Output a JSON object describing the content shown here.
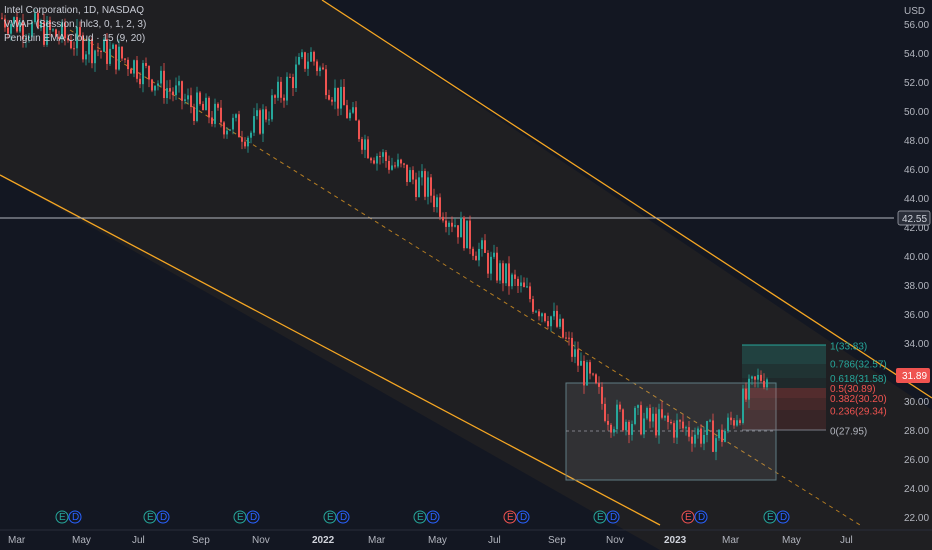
{
  "legend": {
    "symbol": "Intel Corporation, 1D, NASDAQ",
    "vwap": "VWAP (Session, hlc3, 0, 1, 2, 3)",
    "ema_cloud": "Penguin EMA Cloud · 15 (9, 20)"
  },
  "axis": {
    "currency": "USD",
    "y_labels": [
      "56.00",
      "54.00",
      "52.00",
      "50.00",
      "48.00",
      "46.00",
      "44.00",
      "42.00",
      "40.00",
      "38.00",
      "36.00",
      "34.00",
      "32.00",
      "30.00",
      "28.00",
      "26.00",
      "24.00",
      "22.00"
    ],
    "x_labels": [
      "Mar",
      "May",
      "Jul",
      "Sep",
      "Nov",
      "2022",
      "Mar",
      "May",
      "Jul",
      "Sep",
      "Nov",
      "2023",
      "Mar",
      "May",
      "Jul"
    ]
  },
  "tags": {
    "horizontal_line": "42.55",
    "last_price": "31.89"
  },
  "fib": {
    "labels": [
      "1(33.83)",
      "0.786(32.57)",
      "0.618(31.58)",
      "0.5(30.89)",
      "0.382(30.20)",
      "0.236(29.34)",
      "0(27.95)"
    ]
  },
  "colors": {
    "background": "#131722",
    "channel": "#f5a623",
    "up": "#26a69a",
    "down": "#ef5350",
    "hline": "#b2b5be",
    "fib_green": "#26a69a",
    "fib_red": "#ef5350"
  },
  "event_markers": [
    "E",
    "D",
    "E",
    "D",
    "E",
    "D",
    "E",
    "D",
    "E",
    "D",
    "E",
    "D",
    "E",
    "D",
    "E",
    "D",
    "E",
    "D"
  ],
  "chart_data": {
    "type": "candlestick",
    "title": "Intel Corporation, 1D, NASDAQ",
    "ylabel": "USD",
    "ylim": [
      21.5,
      57
    ],
    "x": [
      "2021-03",
      "2021-05",
      "2021-07",
      "2021-09",
      "2021-11",
      "2022-01",
      "2022-03",
      "2022-05",
      "2022-07",
      "2022-09",
      "2022-11",
      "2023-01",
      "2023-03",
      "2023-04"
    ],
    "close": [
      56.5,
      55.0,
      53.5,
      50.5,
      48.5,
      54.0,
      47.5,
      44.5,
      39.5,
      36.0,
      29.0,
      28.5,
      27.5,
      31.89
    ],
    "horizontal_line": 42.55,
    "last_price": 31.89,
    "fib_levels": [
      {
        "ratio": 1,
        "price": 33.83
      },
      {
        "ratio": 0.786,
        "price": 32.57
      },
      {
        "ratio": 0.618,
        "price": 31.58
      },
      {
        "ratio": 0.5,
        "price": 30.89
      },
      {
        "ratio": 0.382,
        "price": 30.2
      },
      {
        "ratio": 0.236,
        "price": 29.34
      },
      {
        "ratio": 0,
        "price": 27.95
      }
    ],
    "range_box": {
      "high": 31.2,
      "low": 24.6
    },
    "channel": "descending parallel channel"
  }
}
